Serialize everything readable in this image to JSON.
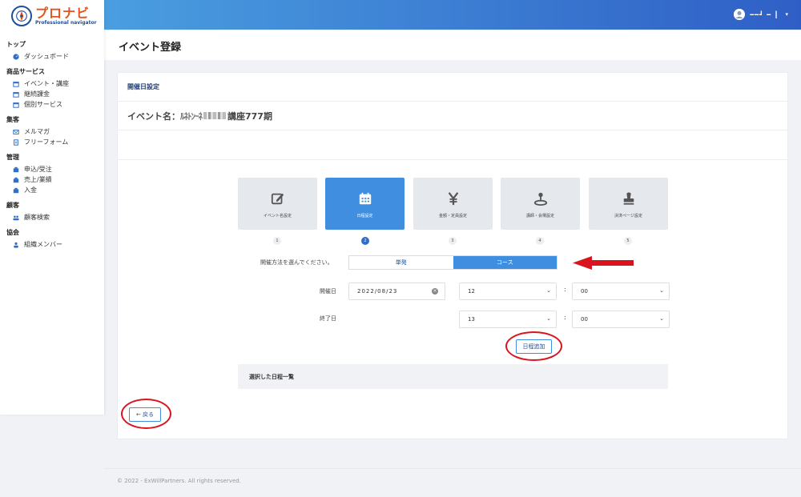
{
  "app": {
    "logo_title": "プロナビ",
    "logo_sub": "Professional navigator"
  },
  "colors": {
    "accent": "#3f8ee0",
    "brand": "#e2531d",
    "annotation": "#d9141e"
  },
  "sidebar": {
    "sections": [
      {
        "title": "トップ",
        "items": [
          {
            "label": "ダッシュボード",
            "icon": "dashboard-icon"
          }
        ]
      },
      {
        "title": "商品サービス",
        "items": [
          {
            "label": "イベント・講座",
            "icon": "calendar-icon"
          },
          {
            "label": "継続課金",
            "icon": "calendar-icon"
          },
          {
            "label": "個別サービス",
            "icon": "calendar-icon"
          }
        ]
      },
      {
        "title": "集客",
        "items": [
          {
            "label": "メルマガ",
            "icon": "mail-icon"
          },
          {
            "label": "フリーフォーム",
            "icon": "form-icon"
          }
        ]
      },
      {
        "title": "管理",
        "items": [
          {
            "label": "申込/受注",
            "icon": "box-icon"
          },
          {
            "label": "売上/業績",
            "icon": "box-icon"
          },
          {
            "label": "入金",
            "icon": "box-icon"
          }
        ]
      },
      {
        "title": "顧客",
        "items": [
          {
            "label": "顧客検索",
            "icon": "users-icon"
          }
        ]
      },
      {
        "title": "協会",
        "items": [
          {
            "label": "組織メンバー",
            "icon": "user-icon"
          }
        ]
      }
    ]
  },
  "header": {
    "user_name": "━━┛ ━ ┃",
    "caret": "▾"
  },
  "page": {
    "title": "イベント登録"
  },
  "card": {
    "header": "開催日設定",
    "event_prefix": "イベント名：",
    "event_masked_a": "ﾙﾈﾄﾝｰﾈ",
    "event_suffix": "講座777期"
  },
  "steps": [
    {
      "label": "イベント名設定",
      "num": "1",
      "icon": "edit-icon"
    },
    {
      "label": "日程設定",
      "num": "2",
      "icon": "calendar-icon"
    },
    {
      "label": "金額・定員設定",
      "num": "3",
      "icon": "yen-icon"
    },
    {
      "label": "講師・会場設定",
      "num": "4",
      "icon": "map-pin-icon"
    },
    {
      "label": "決済ページ設定",
      "num": "5",
      "icon": "stamp-icon"
    }
  ],
  "form": {
    "method_label": "開催方法を選んでください。",
    "method_single": "単発",
    "method_course": "コース",
    "start_label": "開催日",
    "start_date": "2022/08/23",
    "start_hour": "12",
    "start_min": "00",
    "end_label": "終了日",
    "end_hour": "13",
    "end_min": "00",
    "colon": ":",
    "add_button": "日程追加",
    "list_header": "選択した日程一覧",
    "back_button": "← 戻る"
  },
  "footer": {
    "text": "© 2022 - ExWillPartners. All rights reserved."
  }
}
